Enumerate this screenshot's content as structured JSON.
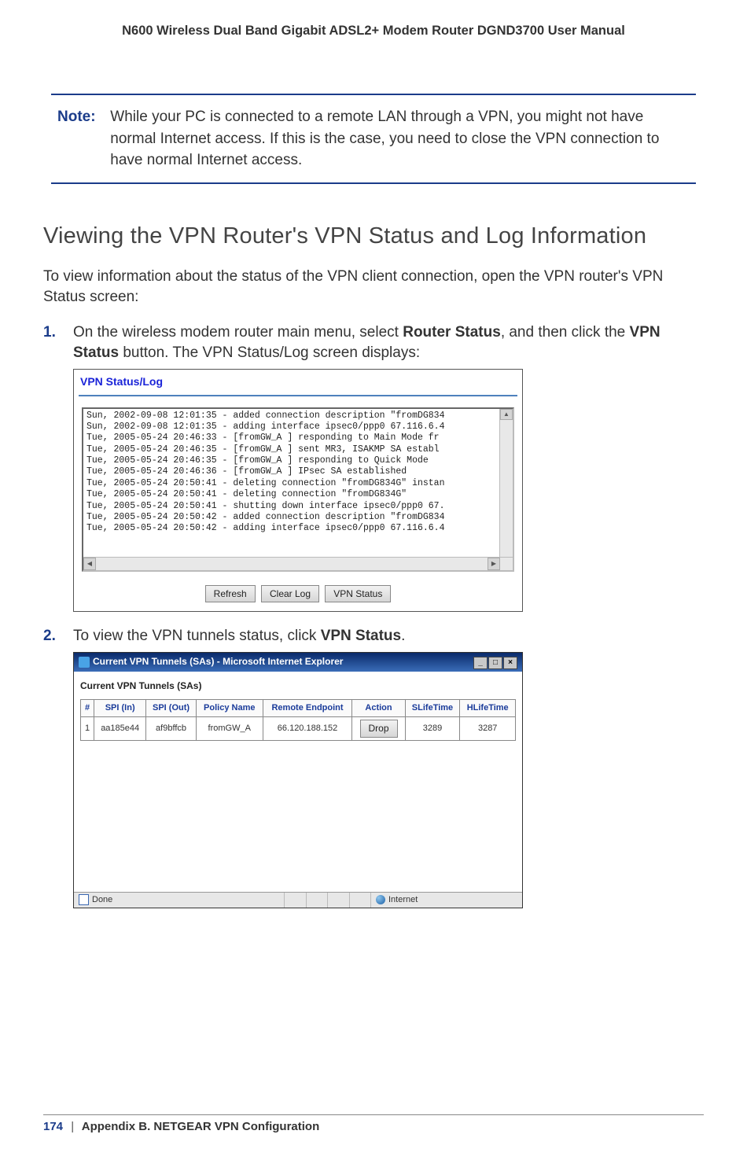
{
  "header": {
    "running_title": "N600 Wireless Dual Band Gigabit ADSL2+ Modem Router DGND3700 User Manual"
  },
  "note": {
    "label": "Note:",
    "text": "While your PC is connected to a remote LAN through a VPN, you might not have normal Internet access. If this is the case, you need to close the VPN connection to have normal Internet access."
  },
  "section": {
    "heading": "Viewing the VPN Router's VPN Status and Log Information",
    "intro": "To view information about the status of the VPN client connection, open the VPN router's VPN Status screen:"
  },
  "steps": {
    "s1_a": "On the wireless modem router main menu, select ",
    "s1_b": "Router Status",
    "s1_c": ", and then click the ",
    "s1_d": "VPN Status",
    "s1_e": " button. The VPN Status/Log screen displays:",
    "s2_a": "To view the VPN tunnels status, click ",
    "s2_b": "VPN Status",
    "s2_c": "."
  },
  "fig1": {
    "title": "VPN Status/Log",
    "log": "Sun, 2002-09-08 12:01:35 - added connection description \"fromDG834\nSun, 2002-09-08 12:01:35 - adding interface ipsec0/ppp0 67.116.6.4\nTue, 2005-05-24 20:46:33 - [fromGW_A ] responding to Main Mode fr\nTue, 2005-05-24 20:46:35 - [fromGW_A ] sent MR3, ISAKMP SA establ\nTue, 2005-05-24 20:46:35 - [fromGW_A ] responding to Quick Mode\nTue, 2005-05-24 20:46:36 - [fromGW_A ] IPsec SA established\nTue, 2005-05-24 20:50:41 - deleting connection \"fromDG834G\" instan\nTue, 2005-05-24 20:50:41 - deleting connection \"fromDG834G\"\nTue, 2005-05-24 20:50:41 - shutting down interface ipsec0/ppp0 67.\nTue, 2005-05-24 20:50:42 - added connection description \"fromDG834\nTue, 2005-05-24 20:50:42 - adding interface ipsec0/ppp0 67.116.6.4",
    "buttons": {
      "refresh": "Refresh",
      "clearlog": "Clear Log",
      "vpnstatus": "VPN Status"
    }
  },
  "fig2": {
    "window_title": "Current VPN Tunnels (SAs) - Microsoft Internet Explorer",
    "panel_title": "Current VPN Tunnels (SAs)",
    "columns": {
      "num": "#",
      "spi_in": "SPI (In)",
      "spi_out": "SPI (Out)",
      "policy": "Policy Name",
      "remote": "Remote Endpoint",
      "action": "Action",
      "slife": "SLifeTime",
      "hlife": "HLifeTime"
    },
    "row": {
      "num": "1",
      "spi_in": "aa185e44",
      "spi_out": "af9bffcb",
      "policy": "fromGW_A",
      "remote": "66.120.188.152",
      "action": "Drop",
      "slife": "3289",
      "hlife": "3287"
    },
    "status": {
      "done": "Done",
      "zone": "Internet"
    }
  },
  "footer": {
    "page": "174",
    "separator": "|",
    "appendix": "Appendix B.  NETGEAR VPN Configuration"
  }
}
